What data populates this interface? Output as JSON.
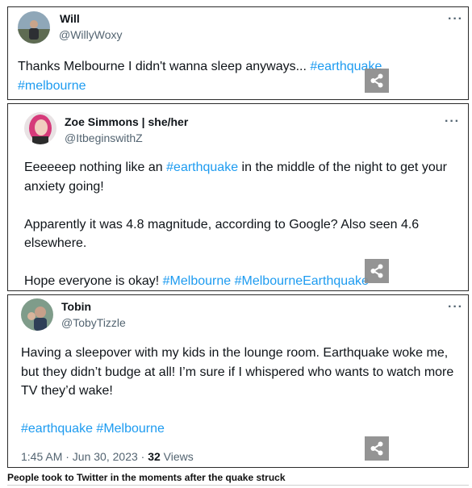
{
  "tweets": [
    {
      "name": "Will",
      "handle": "@WillyWoxy",
      "more": "···",
      "text_plain": "Thanks Melbourne I didn't wanna sleep anyways... ",
      "hashtag_1": "#earthquake",
      "hashtag_2": "#melbourne"
    },
    {
      "name": "Zoe Simmons | she/her",
      "handle": "@ItbeginswithZ",
      "more": "···",
      "para1_before": "Eeeeeep nothing like an ",
      "para1_tag": "#earthquake",
      "para1_after": " in the middle of the night to get your anxiety going!",
      "para2": "Apparently it was 4.8 magnitude, according to Google? Also seen 4.6 elsewhere.",
      "para3_before": "Hope everyone is okay! ",
      "para3_tag1": "#Melbourne",
      "para3_tag2": "#MelbourneEarthquake"
    },
    {
      "name": "Tobin",
      "handle": "@TobyTizzle",
      "more": "···",
      "para1": "Having a sleepover with my kids in the lounge room. Earthquake woke me, but they didn’t budge at all! I’m sure if I whispered who wants to watch more TV they’d wake!",
      "tag1": "#earthquake",
      "tag2": "#Melbourne",
      "timestamp": "1:45 AM · Jun 30, 2023 · ",
      "views_count": "32",
      "views_label": " Views"
    }
  ],
  "caption": "People took to Twitter in the moments after the quake struck",
  "colors": {
    "hashtag": "#1d9bf0",
    "secondary_text": "#536471",
    "share_button": "#8c8c8c"
  }
}
